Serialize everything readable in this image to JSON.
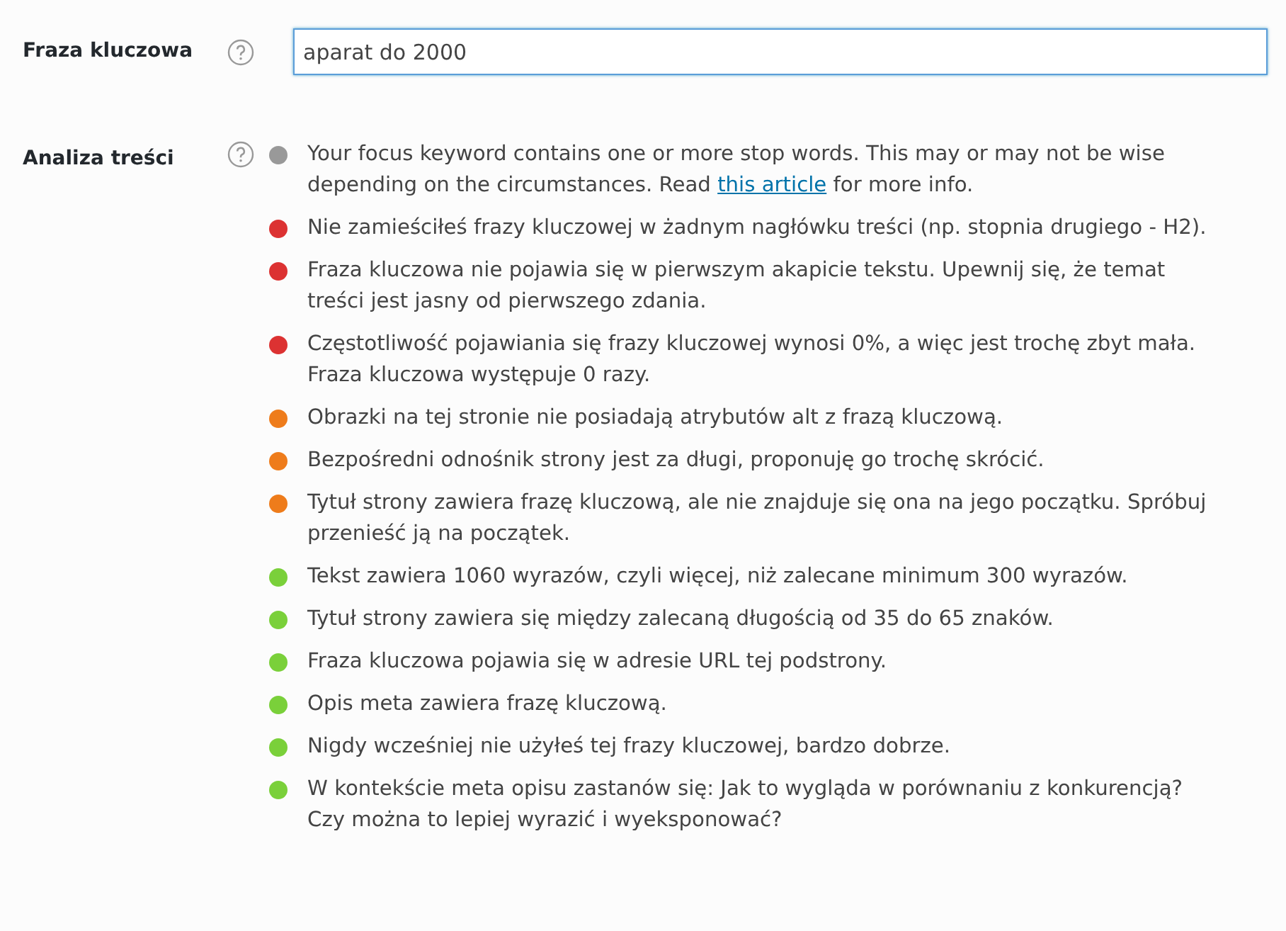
{
  "keyword": {
    "label": "Fraza kluczowa",
    "value": "aparat do 2000",
    "focused": true
  },
  "analysis": {
    "label": "Analiza treści",
    "items": [
      {
        "text": "Your focus keyword contains one or more stop words. This may or may not be wise depending on the circumstances. Read ",
        "link": "this article",
        "after": " for more info.",
        "color": "#999999"
      },
      {
        "text": "Nie zamieściłeś frazy kluczowej w żadnym nagłówku treści (np. stopnia drugiego - H2).",
        "color": "#dc3232"
      },
      {
        "text": "Fraza kluczowa nie pojawia się w pierwszym akapicie tekstu. Upewnij się, że temat treści jest jasny od pierwszego zdania.",
        "color": "#dc3232"
      },
      {
        "text": "Częstotliwość pojawiania się frazy kluczowej wynosi 0%, a więc jest trochę zbyt mała. Fraza kluczowa występuje 0 razy.",
        "color": "#dc3232"
      },
      {
        "text": "Obrazki na tej stronie nie posiadają atrybutów alt z frazą kluczową.",
        "color": "#ee7c1b"
      },
      {
        "text": "Bezpośredni odnośnik strony jest za długi, proponuję go trochę skrócić.",
        "color": "#ee7c1b"
      },
      {
        "text": "Tytuł strony zawiera frazę kluczową, ale nie znajduje się ona na jego początku. Spróbuj przenieść ją na początek.",
        "color": "#ee7c1b"
      },
      {
        "text": "Tekst zawiera 1060 wyrazów, czyli więcej, niż zalecane minimum 300 wyrazów.",
        "color": "#7ad03a"
      },
      {
        "text": "Tytuł strony zawiera się między zalecaną długością od 35 do 65 znaków.",
        "color": "#7ad03a"
      },
      {
        "text": "Fraza kluczowa pojawia się w adresie URL tej podstrony.",
        "color": "#7ad03a"
      },
      {
        "text": "Opis meta zawiera frazę kluczową.",
        "color": "#7ad03a"
      },
      {
        "text": "Nigdy wcześniej nie użyłeś tej frazy kluczowej, bardzo dobrze.",
        "color": "#7ad03a"
      },
      {
        "text": "W kontekście meta opisu zastanów się: Jak to wygląda w porównaniu z konkurencją? Czy można to lepiej wyrazić i wyeksponować?",
        "color": "#7ad03a"
      }
    ]
  }
}
